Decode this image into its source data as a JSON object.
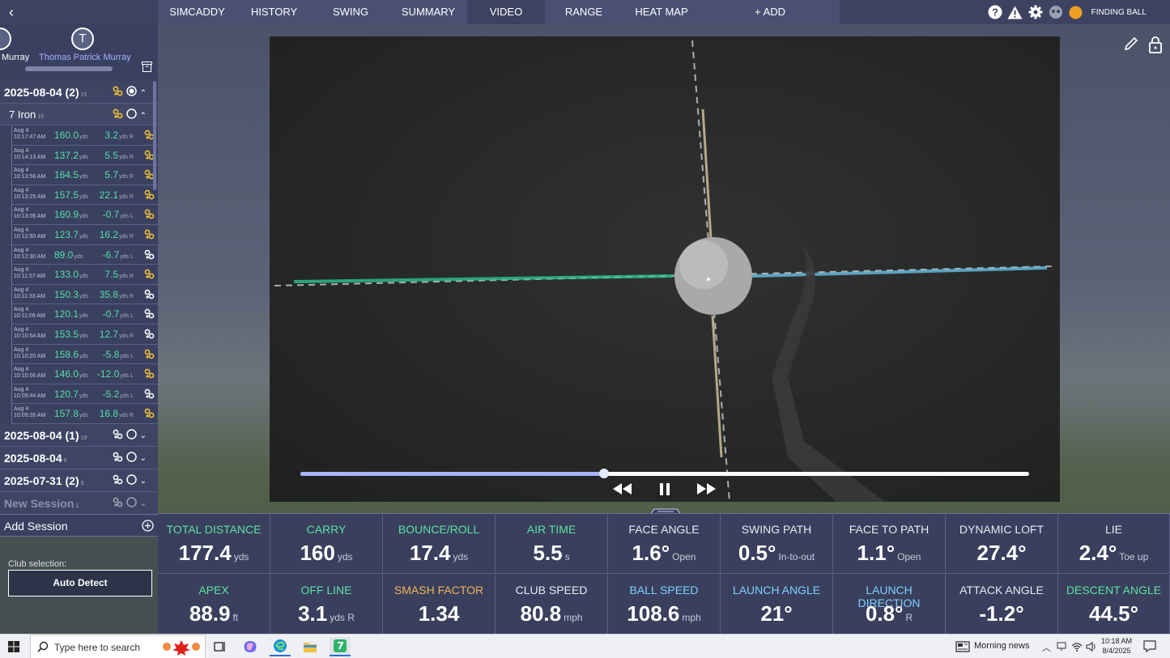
{
  "nav": {
    "tabs": [
      "SIMCADDY",
      "HISTORY",
      "SWING",
      "SUMMARY",
      "VIDEO",
      "RANGE",
      "HEAT MAP",
      "+ ADD"
    ],
    "active_tab": "VIDEO",
    "status": "FINDING BALL"
  },
  "profiles": [
    {
      "name": "Murray",
      "initial": ""
    },
    {
      "name": "Thomas Patrick Murray",
      "initial": "T"
    }
  ],
  "sessions_top": {
    "label": "2025-08-04 (2)",
    "count": "15"
  },
  "club": {
    "label": "7 Iron",
    "count": "15"
  },
  "shots": [
    {
      "date": "Aug 4",
      "time": "10:17:47 AM",
      "dist": "160.0",
      "dist_unit": "yds",
      "off": "3.2",
      "off_unit": "yds R",
      "icon_color": "#f2c233"
    },
    {
      "date": "Aug 4",
      "time": "10:14:13 AM",
      "dist": "137.2",
      "dist_unit": "yds",
      "off": "5.5",
      "off_unit": "yds R",
      "icon_color": "#f2c233"
    },
    {
      "date": "Aug 4",
      "time": "10:13:56 AM",
      "dist": "164.5",
      "dist_unit": "yds",
      "off": "5.7",
      "off_unit": "yds R",
      "icon_color": "#f2c233"
    },
    {
      "date": "Aug 4",
      "time": "10:13:25 AM",
      "dist": "157.5",
      "dist_unit": "yds",
      "off": "22.1",
      "off_unit": "yds R",
      "icon_color": "#f2c233"
    },
    {
      "date": "Aug 4",
      "time": "10:13:06 AM",
      "dist": "160.9",
      "dist_unit": "yds",
      "off": "-0.7",
      "off_unit": "yds L",
      "icon_color": "#f2c233"
    },
    {
      "date": "Aug 4",
      "time": "10:12:50 AM",
      "dist": "123.7",
      "dist_unit": "yds",
      "off": "16.2",
      "off_unit": "yds R",
      "icon_color": "#f2c233"
    },
    {
      "date": "Aug 4",
      "time": "10:12:30 AM",
      "dist": "89.0",
      "dist_unit": "yds",
      "off": "-6.7",
      "off_unit": "yds L",
      "icon_color": "#ffffff"
    },
    {
      "date": "Aug 4",
      "time": "10:11:57 AM",
      "dist": "133.0",
      "dist_unit": "yds",
      "off": "7.5",
      "off_unit": "yds R",
      "icon_color": "#f2c233"
    },
    {
      "date": "Aug 4",
      "time": "10:11:33 AM",
      "dist": "150.3",
      "dist_unit": "yds",
      "off": "35.8",
      "off_unit": "yds R",
      "icon_color": "#ffffff"
    },
    {
      "date": "Aug 4",
      "time": "10:11:09 AM",
      "dist": "120.1",
      "dist_unit": "yds",
      "off": "-0.7",
      "off_unit": "yds L",
      "icon_color": "#ffffff"
    },
    {
      "date": "Aug 4",
      "time": "10:10:54 AM",
      "dist": "153.5",
      "dist_unit": "yds",
      "off": "12.7",
      "off_unit": "yds R",
      "icon_color": "#ffffff"
    },
    {
      "date": "Aug 4",
      "time": "10:10:20 AM",
      "dist": "158.6",
      "dist_unit": "yds",
      "off": "-5.8",
      "off_unit": "yds L",
      "icon_color": "#f2c233"
    },
    {
      "date": "Aug 4",
      "time": "10:10:06 AM",
      "dist": "146.0",
      "dist_unit": "yds",
      "off": "-12.0",
      "off_unit": "yds L",
      "icon_color": "#f2c233"
    },
    {
      "date": "Aug 4",
      "time": "10:09:44 AM",
      "dist": "120.7",
      "dist_unit": "yds",
      "off": "-5.2",
      "off_unit": "yds L",
      "icon_color": "#ffffff"
    },
    {
      "date": "Aug 4",
      "time": "10:09:26 AM",
      "dist": "157.8",
      "dist_unit": "yds",
      "off": "16.8",
      "off_unit": "yds R",
      "icon_color": "#f2c233"
    }
  ],
  "sessions_bottom": [
    {
      "label": "2025-08-04 (1)",
      "count": "19"
    },
    {
      "label": "2025-08-04",
      "count": "6"
    },
    {
      "label": "2025-07-31 (2)",
      "count": "9"
    },
    {
      "label": "New Session",
      "count": "1"
    }
  ],
  "add_session": "Add Session",
  "club_selection": {
    "label": "Club selection:",
    "value": "Auto Detect"
  },
  "video": {
    "progress": 0.417
  },
  "stats_row1": [
    {
      "title": "TOTAL DISTANCE",
      "value": "177.4",
      "unit": "yds",
      "color": "green"
    },
    {
      "title": "CARRY",
      "value": "160",
      "unit": "yds",
      "color": "green"
    },
    {
      "title": "BOUNCE/ROLL",
      "value": "17.4",
      "unit": "yds",
      "color": "green"
    },
    {
      "title": "AIR TIME",
      "value": "5.5",
      "unit": "s",
      "color": "green"
    },
    {
      "title": "FACE ANGLE",
      "value": "1.6°",
      "unit": "Open",
      "color": "white"
    },
    {
      "title": "SWING PATH",
      "value": "0.5°",
      "unit": "In-to-out",
      "color": "white"
    },
    {
      "title": "FACE TO PATH",
      "value": "1.1°",
      "unit": "Open",
      "color": "white"
    },
    {
      "title": "DYNAMIC LOFT",
      "value": "27.4°",
      "unit": "",
      "color": "white"
    },
    {
      "title": "LIE",
      "value": "2.4°",
      "unit": "Toe up",
      "color": "white"
    }
  ],
  "stats_row2": [
    {
      "title": "APEX",
      "value": "88.9",
      "unit": "ft",
      "color": "green"
    },
    {
      "title": "OFF LINE",
      "value": "3.1",
      "unit": "yds R",
      "color": "green"
    },
    {
      "title": "SMASH FACTOR",
      "value": "1.34",
      "unit": "",
      "color": "orange"
    },
    {
      "title": "CLUB SPEED",
      "value": "80.8",
      "unit": "mph",
      "color": "white"
    },
    {
      "title": "BALL SPEED",
      "value": "108.6",
      "unit": "mph",
      "color": "cyan"
    },
    {
      "title": "LAUNCH ANGLE",
      "value": "21°",
      "unit": "",
      "color": "cyan"
    },
    {
      "title": "LAUNCH DIRECTION",
      "value": "0.8°",
      "unit": "R",
      "color": "cyan"
    },
    {
      "title": "ATTACK ANGLE",
      "value": "-1.2°",
      "unit": "",
      "color": "white"
    },
    {
      "title": "DESCENT ANGLE",
      "value": "44.5°",
      "unit": "",
      "color": "green"
    }
  ],
  "taskbar": {
    "search_placeholder": "Type here to search",
    "news": "Morning news",
    "time": "10:18 AM",
    "date": "8/4/2025"
  }
}
